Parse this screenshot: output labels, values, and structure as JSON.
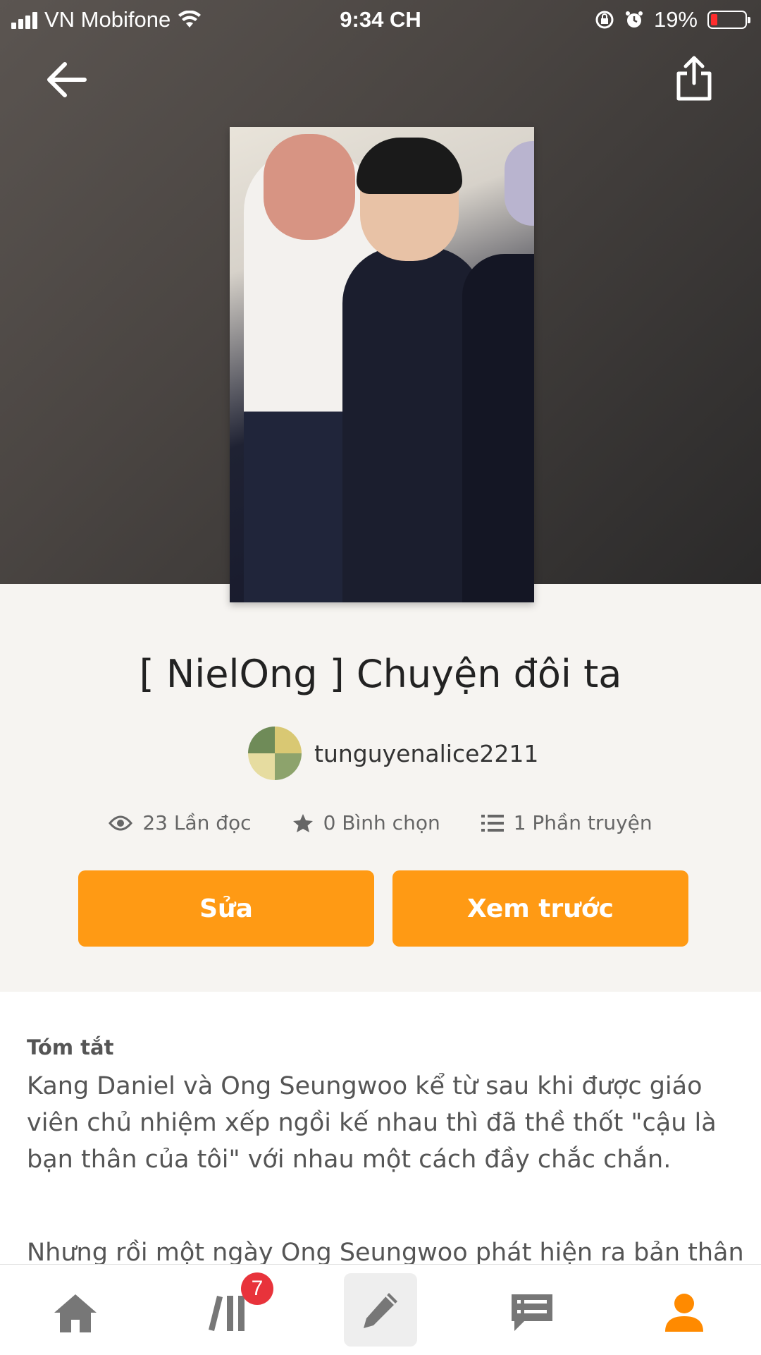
{
  "status_bar": {
    "carrier": "VN Mobifone",
    "time": "9:34 CH",
    "battery": "19%"
  },
  "story": {
    "title": "[ NielOng ] Chuyện đôi ta",
    "author": "tunguyenalice2211",
    "reads": "23 Lần đọc",
    "votes": "0 Bình chọn",
    "parts": "1 Phần truyện"
  },
  "actions": {
    "edit_label": "Sửa",
    "preview_label": "Xem trước"
  },
  "summary": {
    "heading": "Tóm tắt",
    "paragraph1": "Kang Daniel và Ong Seungwoo kể từ sau khi được giáo viên chủ nhiệm xếp ngồi kế nhau thì đã thề thốt \"cậu là bạn thân của tôi\" với nhau một cách đầy chắc chắn.",
    "paragraph2": "Nhưng rồi một ngày Ong Seungwoo phát hiện ra bản thân"
  },
  "tabbar": {
    "items": [
      "home-icon",
      "library-icon",
      "write-icon",
      "messages-icon",
      "profile-icon"
    ],
    "library_badge": "7"
  },
  "colors": {
    "accent": "#ff9a14",
    "badge": "#e8333b",
    "active_tab": "#ff8a00"
  }
}
